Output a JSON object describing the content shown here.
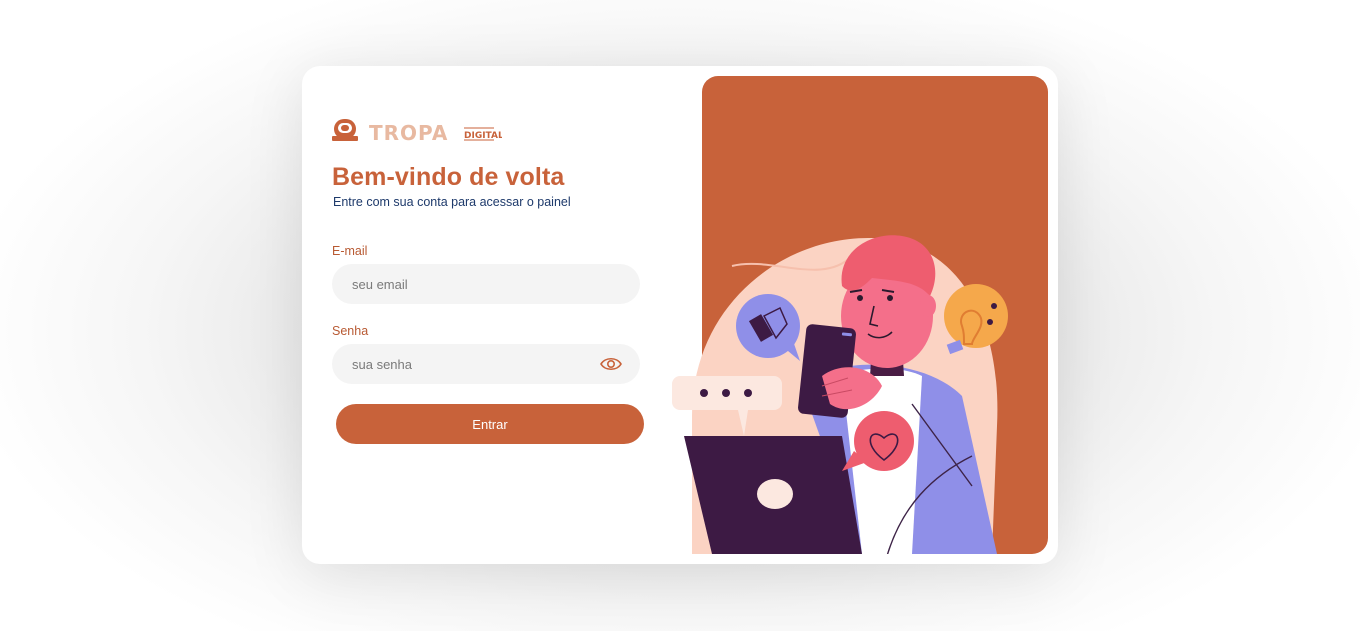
{
  "brand": {
    "logo_text": "TROPA",
    "logo_subtext": "DIGITAL"
  },
  "login": {
    "title": "Bem-vindo de volta",
    "subtitle": "Entre com sua conta para acessar o painel",
    "email_label": "E-mail",
    "email_placeholder": "seu email",
    "email_value": "",
    "password_label": "Senha",
    "password_placeholder": "sua senha",
    "password_value": "",
    "submit_label": "Entrar"
  },
  "colors": {
    "accent": "#c8623a",
    "subtitle_text": "#1e3a6b",
    "input_bg": "#f4f4f4",
    "illustration_bg": "#fbd3c3"
  },
  "icons": {
    "logo": "astronaut-helmet-icon",
    "password_toggle": "eye-icon"
  }
}
